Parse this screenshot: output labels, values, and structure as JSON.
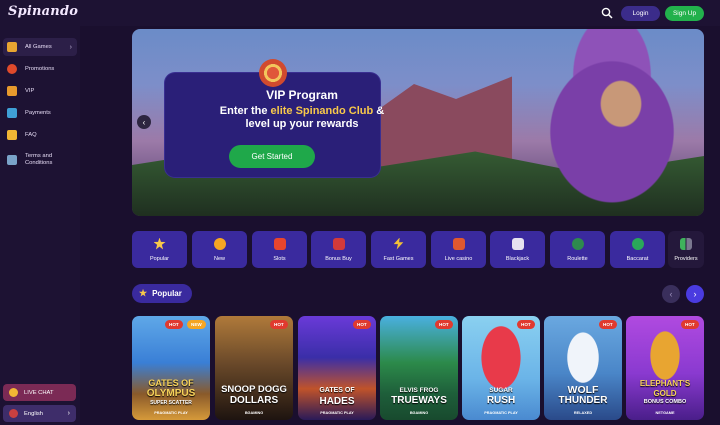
{
  "header": {
    "logo": "Spinando",
    "login_label": "Login",
    "signup_label": "Sign Up"
  },
  "sidebar": {
    "items": [
      {
        "label": "All Games",
        "icon": "shield-icon",
        "color": "#e8a531"
      },
      {
        "label": "Promotions",
        "icon": "wheel-icon",
        "color": "#e04a2b"
      },
      {
        "label": "VIP",
        "icon": "crown-icon",
        "color": "#e89a2d"
      },
      {
        "label": "Payments",
        "icon": "payment-icon",
        "color": "#3fa0d6"
      },
      {
        "label": "FAQ",
        "icon": "faq-icon",
        "color": "#f2b634"
      },
      {
        "label": "Terms and",
        "label2": "Conditions",
        "icon": "document-icon",
        "color": "#7aa3c9"
      }
    ],
    "live_chat": "LIVE CHAT",
    "language": "English"
  },
  "banner": {
    "title": "VIP Program",
    "line1_pre": "Enter the ",
    "line1_highlight": "elite Spinando Club",
    "line1_post": " &",
    "line2": "level up your rewards",
    "cta": "Get Started"
  },
  "categories": [
    {
      "label": "Popular",
      "color": "#f8c94a"
    },
    {
      "label": "New",
      "color": "#f5a623"
    },
    {
      "label": "Slots",
      "color": "#e8452e"
    },
    {
      "label": "Bonus Buy",
      "color": "#d23a3a"
    },
    {
      "label": "Fast Games",
      "color": "#f2c037"
    },
    {
      "label": "Live casino",
      "color": "#e0582f"
    },
    {
      "label": "Blackjack",
      "color": "#e6e2f0"
    },
    {
      "label": "Roulette",
      "color": "#2e8a4e"
    },
    {
      "label": "Baccarat",
      "color": "#2aa85a"
    },
    {
      "label": "Providers",
      "color": "#3fb35c"
    }
  ],
  "popular": {
    "title": "Popular",
    "games": [
      {
        "line1": "GATES OF",
        "line2": "OLYMPUS",
        "line3": "SUPER SCATTER",
        "provider": "PRAGMATIC PLAY",
        "tags": [
          "HOT",
          "NEW"
        ],
        "bg": "#3a7fd6"
      },
      {
        "line1": "SNOOP DOGG",
        "line2": "DOLLARS",
        "line3": "",
        "provider": "BGAMING",
        "tags": [
          "HOT"
        ],
        "bg": "#6b4a2a"
      },
      {
        "line1": "GATES OF",
        "line2": "HADES",
        "line3": "",
        "provider": "PRAGMATIC PLAY",
        "tags": [
          "HOT"
        ],
        "bg": "#3a2ea8"
      },
      {
        "line1": "ELVIS FROG",
        "line2": "TRUEWAYS",
        "line3": "",
        "provider": "BGAMING",
        "tags": [
          "HOT"
        ],
        "bg": "#2c8a4a"
      },
      {
        "line1": "SUGAR",
        "line2": "RUSH",
        "line3": "",
        "provider": "PRAGMATIC PLAY",
        "tags": [
          "HOT"
        ],
        "bg": "#6bb4e8"
      },
      {
        "line1": "WOLF",
        "line2": "THUNDER",
        "line3": "",
        "provider": "RELAXED",
        "tags": [
          "HOT"
        ],
        "bg": "#4a86c8"
      },
      {
        "line1": "ELEPHANT'S",
        "line2": "GOLD",
        "line3": "BONUS COMBO",
        "provider": "NETGAME",
        "tags": [
          "HOT"
        ],
        "bg": "#8a3ad0"
      }
    ]
  }
}
